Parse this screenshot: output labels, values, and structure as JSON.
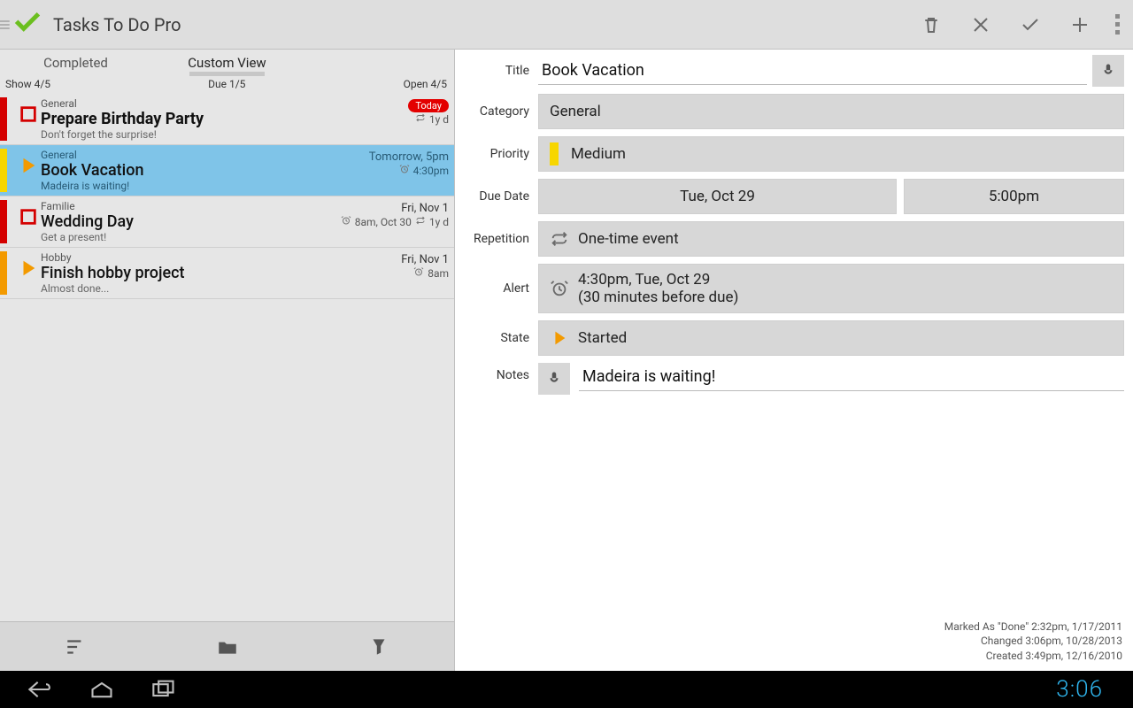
{
  "app_title": "Tasks To Do Pro",
  "tabs": {
    "completed": "Completed",
    "custom": "Custom View"
  },
  "counters": {
    "show": "Show 4/5",
    "due": "Due 1/5",
    "open": "Open 4/5"
  },
  "tasks": [
    {
      "priority_color": "#d40000",
      "icon": "square",
      "category": "General",
      "title": "Prepare Birthday Party",
      "note": "Don't forget the surprise!",
      "due_badge": "Today",
      "line2_icon": "repeat",
      "line2_text": "1y d",
      "selected": false,
      "bold": true
    },
    {
      "priority_color": "#f7d600",
      "icon": "play",
      "category": "General",
      "title": "Book Vacation",
      "note": "Madeira is waiting!",
      "due_text": "Tomorrow, 5pm",
      "line2_icon": "alarm",
      "line2_text": "4:30pm",
      "selected": true,
      "bold": false
    },
    {
      "priority_color": "#d40000",
      "icon": "square",
      "category": "Familie",
      "title": "Wedding Day",
      "note": "Get a present!",
      "due_text": "Fri, Nov 1",
      "line2_icon": "alarm",
      "line2_text": "8am, Oct 30",
      "line2b_icon": "repeat",
      "line2b_text": "1y d",
      "selected": false,
      "bold": false
    },
    {
      "priority_color": "#f39a00",
      "icon": "play",
      "category": "Hobby",
      "title": "Finish hobby project",
      "note": "Almost done...",
      "due_text": "Fri, Nov 1",
      "line2_icon": "alarm",
      "line2_text": "8am",
      "selected": false,
      "bold": false
    }
  ],
  "detail": {
    "labels": {
      "title": "Title",
      "category": "Category",
      "priority": "Priority",
      "due": "Due Date",
      "repetition": "Repetition",
      "alert": "Alert",
      "state": "State",
      "notes": "Notes"
    },
    "title": "Book Vacation",
    "category": "General",
    "priority": "Medium",
    "due_date": "Tue, Oct 29",
    "due_time": "5:00pm",
    "repetition": "One-time event",
    "alert_line1": "4:30pm, Tue, Oct 29",
    "alert_line2": "(30 minutes before due)",
    "state": "Started",
    "notes": "Madeira is waiting!"
  },
  "footer": {
    "done": "Marked As \"Done\" 2:32pm, 1/17/2011",
    "changed": "Changed 3:06pm, 10/28/2013",
    "created": "Created 3:49pm, 12/16/2010"
  },
  "status": {
    "clock": "3:06"
  }
}
